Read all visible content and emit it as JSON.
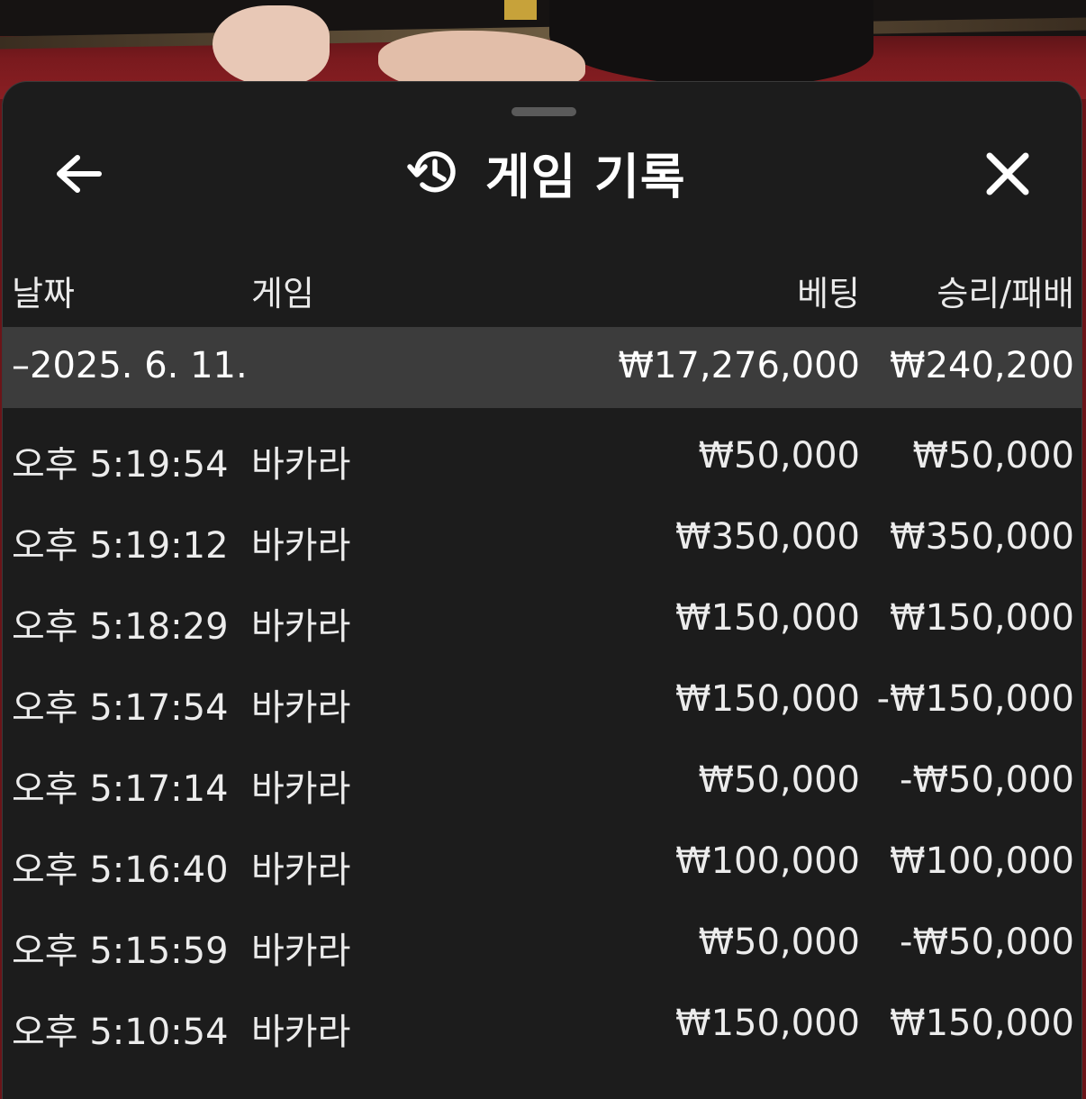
{
  "header": {
    "title": "게임 기록"
  },
  "table": {
    "headers": {
      "date": "날짜",
      "game": "게임",
      "bet": "베팅",
      "result": "승리/패배"
    },
    "summary": {
      "date": "–2025. 6. 11.",
      "bet": "₩17,276,000",
      "result": "₩240,200"
    },
    "rows": [
      {
        "time": "오후 5:19:54",
        "game": "바카라",
        "bet": "₩50,000",
        "result": "₩50,000"
      },
      {
        "time": "오후 5:19:12",
        "game": "바카라",
        "bet": "₩350,000",
        "result": "₩350,000"
      },
      {
        "time": "오후 5:18:29",
        "game": "바카라",
        "bet": "₩150,000",
        "result": "₩150,000"
      },
      {
        "time": "오후 5:17:54",
        "game": "바카라",
        "bet": "₩150,000",
        "result": "-₩150,000"
      },
      {
        "time": "오후 5:17:14",
        "game": "바카라",
        "bet": "₩50,000",
        "result": "-₩50,000"
      },
      {
        "time": "오후 5:16:40",
        "game": "바카라",
        "bet": "₩100,000",
        "result": "₩100,000"
      },
      {
        "time": "오후 5:15:59",
        "game": "바카라",
        "bet": "₩50,000",
        "result": "-₩50,000"
      },
      {
        "time": "오후 5:10:54",
        "game": "바카라",
        "bet": "₩150,000",
        "result": "₩150,000"
      }
    ]
  },
  "icons": {
    "back": "arrow-left-icon",
    "history": "history-icon",
    "close": "close-icon"
  },
  "colors": {
    "sheet_background": "#1c1c1c",
    "summary_background": "#3c3c3c",
    "text": "#ececec"
  }
}
